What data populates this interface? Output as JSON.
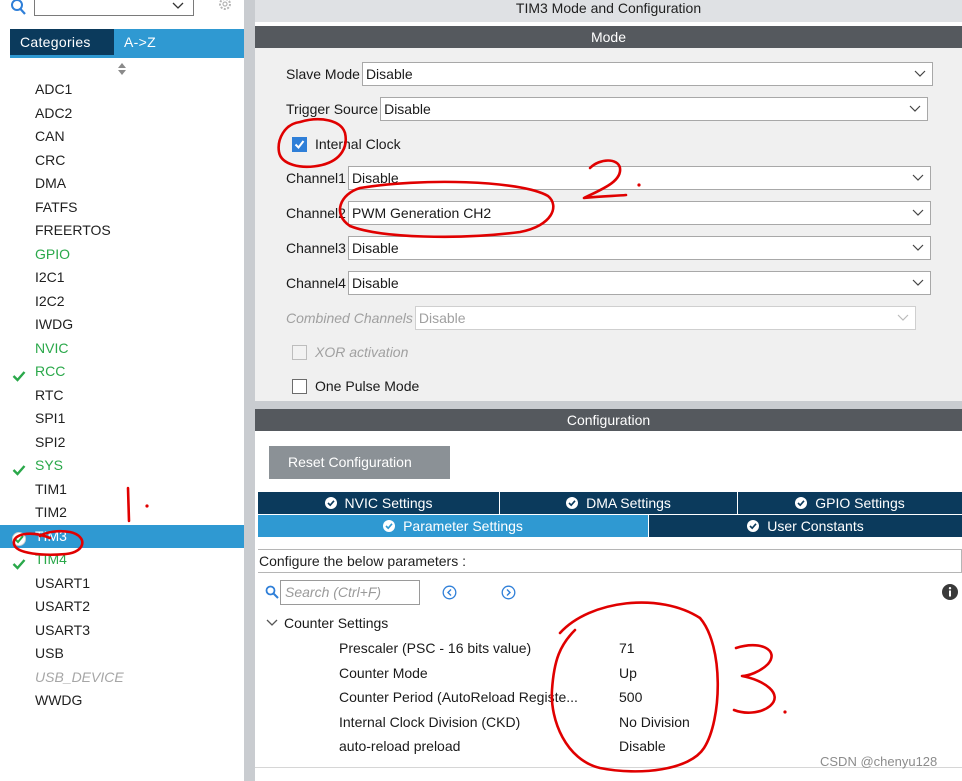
{
  "left": {
    "tabs": {
      "categories": "Categories",
      "az": "A->Z"
    },
    "items": [
      {
        "label": "ADC1",
        "state": "normal"
      },
      {
        "label": "ADC2",
        "state": "normal"
      },
      {
        "label": "CAN",
        "state": "normal"
      },
      {
        "label": "CRC",
        "state": "normal"
      },
      {
        "label": "DMA",
        "state": "normal"
      },
      {
        "label": "FATFS",
        "state": "normal"
      },
      {
        "label": "FREERTOS",
        "state": "normal"
      },
      {
        "label": "GPIO",
        "state": "green"
      },
      {
        "label": "I2C1",
        "state": "normal"
      },
      {
        "label": "I2C2",
        "state": "normal"
      },
      {
        "label": "IWDG",
        "state": "normal"
      },
      {
        "label": "NVIC",
        "state": "green"
      },
      {
        "label": "RCC",
        "state": "green-check"
      },
      {
        "label": "RTC",
        "state": "normal"
      },
      {
        "label": "SPI1",
        "state": "normal"
      },
      {
        "label": "SPI2",
        "state": "normal"
      },
      {
        "label": "SYS",
        "state": "green-check"
      },
      {
        "label": "TIM1",
        "state": "normal"
      },
      {
        "label": "TIM2",
        "state": "normal"
      },
      {
        "label": "TIM3",
        "state": "selected"
      },
      {
        "label": "TIM4",
        "state": "green-check"
      },
      {
        "label": "USART1",
        "state": "normal"
      },
      {
        "label": "USART2",
        "state": "normal"
      },
      {
        "label": "USART3",
        "state": "normal"
      },
      {
        "label": "USB",
        "state": "normal"
      },
      {
        "label": "USB_DEVICE",
        "state": "disabled"
      },
      {
        "label": "WWDG",
        "state": "normal"
      }
    ]
  },
  "right": {
    "title": "TIM3 Mode and Configuration",
    "mode": {
      "header": "Mode",
      "slave_mode": {
        "label": "Slave Mode",
        "value": "Disable"
      },
      "trigger_source": {
        "label": "Trigger Source",
        "value": "Disable"
      },
      "internal_clock": {
        "label": "Internal Clock",
        "checked": true
      },
      "channel1": {
        "label": "Channel1",
        "value": "Disable"
      },
      "channel2": {
        "label": "Channel2",
        "value": "PWM Generation CH2"
      },
      "channel3": {
        "label": "Channel3",
        "value": "Disable"
      },
      "channel4": {
        "label": "Channel4",
        "value": "Disable"
      },
      "combined": {
        "label": "Combined Channels",
        "value": "Disable"
      },
      "xor": {
        "label": "XOR activation",
        "checked": false
      },
      "one_pulse": {
        "label": "One Pulse Mode",
        "checked": false
      }
    },
    "configuration": {
      "header": "Configuration",
      "reset_label": "Reset Configuration",
      "tabs": {
        "nvic": "NVIC Settings",
        "dma": "DMA Settings",
        "gpio": "GPIO Settings",
        "parameter": "Parameter Settings",
        "user_constants": "User Constants"
      },
      "caption": "Configure the below parameters :",
      "search_placeholder": "Search (Ctrl+F)",
      "counter_settings": {
        "label": "Counter Settings",
        "params": [
          {
            "name": "Prescaler (PSC - 16 bits value)",
            "value": "71"
          },
          {
            "name": "Counter Mode",
            "value": "Up"
          },
          {
            "name": "Counter Period (AutoReload Registe...",
            "value": "500"
          },
          {
            "name": "Internal Clock Division (CKD)",
            "value": "No Division"
          },
          {
            "name": "auto-reload preload",
            "value": "Disable"
          }
        ]
      }
    }
  },
  "annotations": {
    "mark1": "1.",
    "mark2": "2.",
    "mark3": "3."
  },
  "watermark": "CSDN @chenyu128",
  "colors": {
    "accent_blue": "#2f99d2",
    "dark_navy": "#0b3a5c",
    "header_gray": "#55595e",
    "ok_green": "#2aa84a",
    "ink_red": "#e00000"
  }
}
